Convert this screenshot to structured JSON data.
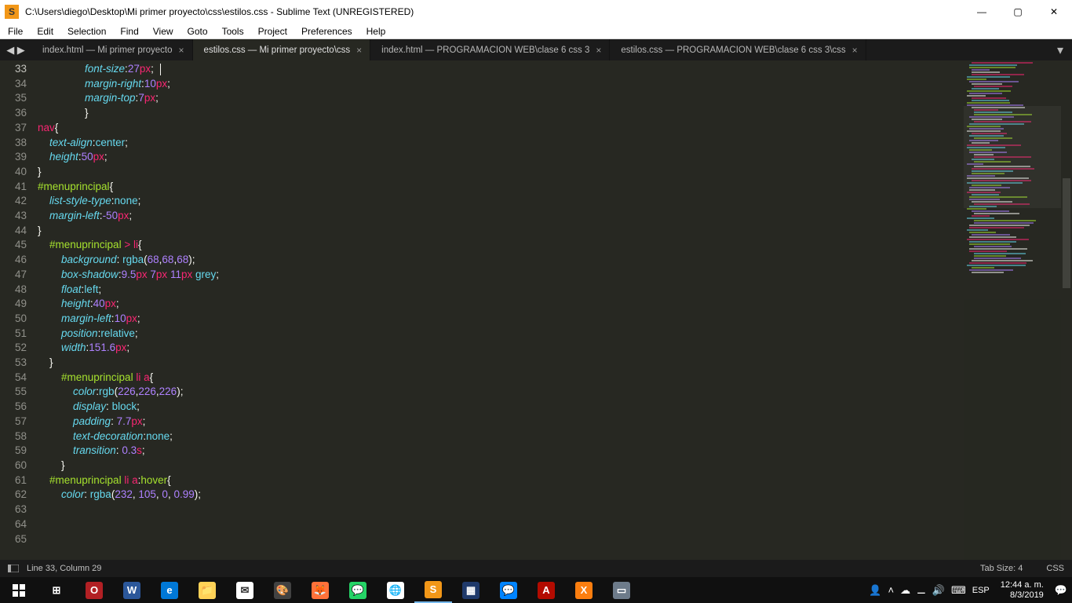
{
  "window": {
    "title": "C:\\Users\\diego\\Desktop\\Mi primer proyecto\\css\\estilos.css - Sublime Text (UNREGISTERED)",
    "app_icon_letter": "S"
  },
  "menubar": [
    "File",
    "Edit",
    "Selection",
    "Find",
    "View",
    "Goto",
    "Tools",
    "Project",
    "Preferences",
    "Help"
  ],
  "tabs": [
    {
      "label": "index.html — Mi primer proyecto",
      "active": false
    },
    {
      "label": "estilos.css — Mi primer proyecto\\css",
      "active": true
    },
    {
      "label": "index.html — PROGRAMACION  WEB\\clase 6 css 3",
      "active": false
    },
    {
      "label": "estilos.css — PROGRAMACION  WEB\\clase 6 css 3\\css",
      "active": false
    }
  ],
  "gutter": {
    "start": 33,
    "end": 65,
    "highlight": 33
  },
  "code_lines": [
    {
      "n": 33,
      "indent": "                ",
      "tokens": [
        [
          "prop",
          "font-size"
        ],
        [
          "punct",
          ":"
        ],
        [
          "num",
          "27"
        ],
        [
          "unit",
          "px"
        ],
        [
          "punct",
          ";"
        ]
      ],
      "cursor": true
    },
    {
      "n": 34,
      "indent": "                ",
      "tokens": [
        [
          "prop",
          "margin-right"
        ],
        [
          "punct",
          ":"
        ],
        [
          "num",
          "10"
        ],
        [
          "unit",
          "px"
        ],
        [
          "punct",
          ";"
        ]
      ]
    },
    {
      "n": 35,
      "indent": "                ",
      "tokens": [
        [
          "prop",
          "margin-top"
        ],
        [
          "punct",
          ":"
        ],
        [
          "num",
          "7"
        ],
        [
          "unit",
          "px"
        ],
        [
          "punct",
          ";"
        ]
      ]
    },
    {
      "n": 36,
      "indent": "                ",
      "tokens": [
        [
          "brace",
          "}"
        ]
      ]
    },
    {
      "n": 37,
      "indent": "",
      "tokens": []
    },
    {
      "n": 38,
      "indent": "",
      "tokens": [
        [
          "tagsel",
          "nav"
        ],
        [
          "brace",
          "{"
        ]
      ]
    },
    {
      "n": 39,
      "indent": "    ",
      "tokens": [
        [
          "prop",
          "text-align"
        ],
        [
          "punct",
          ":"
        ],
        [
          "val",
          "center"
        ],
        [
          "punct",
          ";"
        ]
      ]
    },
    {
      "n": 40,
      "indent": "    ",
      "tokens": [
        [
          "prop",
          "height"
        ],
        [
          "punct",
          ":"
        ],
        [
          "num",
          "50"
        ],
        [
          "unit",
          "px"
        ],
        [
          "punct",
          ";"
        ]
      ]
    },
    {
      "n": 41,
      "indent": "",
      "tokens": [
        [
          "brace",
          "}"
        ]
      ]
    },
    {
      "n": 42,
      "indent": "",
      "tokens": []
    },
    {
      "n": 43,
      "indent": "",
      "tokens": [
        [
          "idsel",
          "#menuprincipal"
        ],
        [
          "brace",
          "{"
        ]
      ]
    },
    {
      "n": 44,
      "indent": "    ",
      "tokens": [
        [
          "prop",
          "list-style-type"
        ],
        [
          "punct",
          ":"
        ],
        [
          "val",
          "none"
        ],
        [
          "punct",
          ";"
        ]
      ]
    },
    {
      "n": 45,
      "indent": "    ",
      "tokens": [
        [
          "prop",
          "margin-left"
        ],
        [
          "punct",
          ":"
        ],
        [
          "num",
          "-50"
        ],
        [
          "unit",
          "px"
        ],
        [
          "punct",
          ";"
        ]
      ]
    },
    {
      "n": 46,
      "indent": "",
      "tokens": [
        [
          "brace",
          "}"
        ]
      ]
    },
    {
      "n": 47,
      "indent": "    ",
      "tokens": [
        [
          "idsel",
          "#menuprincipal"
        ],
        [
          "punct",
          " "
        ],
        [
          "op",
          ">"
        ],
        [
          "punct",
          " "
        ],
        [
          "tagsel",
          "li"
        ],
        [
          "brace",
          "{"
        ]
      ]
    },
    {
      "n": 48,
      "indent": "        ",
      "tokens": [
        [
          "prop",
          "background"
        ],
        [
          "punct",
          ": "
        ],
        [
          "rgbfn",
          "rgba"
        ],
        [
          "paren",
          "("
        ],
        [
          "num",
          "68"
        ],
        [
          "comma",
          ","
        ],
        [
          "num",
          "68"
        ],
        [
          "comma",
          ","
        ],
        [
          "num",
          "68"
        ],
        [
          "paren",
          ")"
        ],
        [
          "punct",
          ";"
        ]
      ]
    },
    {
      "n": 49,
      "indent": "        ",
      "tokens": [
        [
          "prop",
          "box-shadow"
        ],
        [
          "punct",
          ":"
        ],
        [
          "num",
          "9.5"
        ],
        [
          "unit",
          "px"
        ],
        [
          "punct",
          " "
        ],
        [
          "num",
          "7"
        ],
        [
          "unit",
          "px"
        ],
        [
          "punct",
          " "
        ],
        [
          "num",
          "11"
        ],
        [
          "unit",
          "px"
        ],
        [
          "punct",
          " "
        ],
        [
          "val",
          "grey"
        ],
        [
          "punct",
          ";"
        ]
      ]
    },
    {
      "n": 50,
      "indent": "        ",
      "tokens": [
        [
          "prop",
          "float"
        ],
        [
          "punct",
          ":"
        ],
        [
          "val",
          "left"
        ],
        [
          "punct",
          ";"
        ]
      ]
    },
    {
      "n": 51,
      "indent": "        ",
      "tokens": [
        [
          "prop",
          "height"
        ],
        [
          "punct",
          ":"
        ],
        [
          "num",
          "40"
        ],
        [
          "unit",
          "px"
        ],
        [
          "punct",
          ";"
        ]
      ]
    },
    {
      "n": 52,
      "indent": "        ",
      "tokens": [
        [
          "prop",
          "margin-left"
        ],
        [
          "punct",
          ":"
        ],
        [
          "num",
          "10"
        ],
        [
          "unit",
          "px"
        ],
        [
          "punct",
          ";"
        ]
      ]
    },
    {
      "n": 53,
      "indent": "        ",
      "tokens": [
        [
          "prop",
          "position"
        ],
        [
          "punct",
          ":"
        ],
        [
          "val",
          "relative"
        ],
        [
          "punct",
          ";"
        ]
      ]
    },
    {
      "n": 54,
      "indent": "        ",
      "tokens": [
        [
          "prop",
          "width"
        ],
        [
          "punct",
          ":"
        ],
        [
          "num",
          "151.6"
        ],
        [
          "unit",
          "px"
        ],
        [
          "punct",
          ";"
        ]
      ]
    },
    {
      "n": 55,
      "indent": "",
      "tokens": []
    },
    {
      "n": 56,
      "indent": "    ",
      "tokens": [
        [
          "brace",
          "}"
        ]
      ]
    },
    {
      "n": 57,
      "indent": "        ",
      "tokens": [
        [
          "idsel",
          "#menuprincipal"
        ],
        [
          "punct",
          " "
        ],
        [
          "tagsel",
          "li"
        ],
        [
          "punct",
          " "
        ],
        [
          "tagsel",
          "a"
        ],
        [
          "brace",
          "{"
        ]
      ]
    },
    {
      "n": 58,
      "indent": "            ",
      "tokens": [
        [
          "prop",
          "color"
        ],
        [
          "punct",
          ":"
        ],
        [
          "rgbfn",
          "rgb"
        ],
        [
          "paren",
          "("
        ],
        [
          "num",
          "226"
        ],
        [
          "comma",
          ","
        ],
        [
          "num",
          "226"
        ],
        [
          "comma",
          ","
        ],
        [
          "num",
          "226"
        ],
        [
          "paren",
          ")"
        ],
        [
          "punct",
          ";"
        ]
      ]
    },
    {
      "n": 59,
      "indent": "            ",
      "tokens": [
        [
          "prop",
          "display"
        ],
        [
          "punct",
          ": "
        ],
        [
          "val",
          "block"
        ],
        [
          "punct",
          ";"
        ]
      ]
    },
    {
      "n": 60,
      "indent": "            ",
      "tokens": [
        [
          "prop",
          "padding"
        ],
        [
          "punct",
          ": "
        ],
        [
          "num",
          "7.7"
        ],
        [
          "unit",
          "px"
        ],
        [
          "punct",
          ";"
        ]
      ]
    },
    {
      "n": 61,
      "indent": "            ",
      "tokens": [
        [
          "prop",
          "text-decoration"
        ],
        [
          "punct",
          ":"
        ],
        [
          "val",
          "none"
        ],
        [
          "punct",
          ";"
        ]
      ]
    },
    {
      "n": 62,
      "indent": "            ",
      "tokens": [
        [
          "prop",
          "transition"
        ],
        [
          "punct",
          ": "
        ],
        [
          "num",
          "0.3"
        ],
        [
          "unit",
          "s"
        ],
        [
          "punct",
          ";"
        ]
      ]
    },
    {
      "n": 63,
      "indent": "        ",
      "tokens": [
        [
          "brace",
          "}"
        ]
      ]
    },
    {
      "n": 64,
      "indent": "    ",
      "tokens": [
        [
          "idsel",
          "#menuprincipal"
        ],
        [
          "punct",
          " "
        ],
        [
          "tagsel",
          "li"
        ],
        [
          "punct",
          " "
        ],
        [
          "tagsel",
          "a"
        ],
        [
          "punct",
          ":"
        ],
        [
          "pseudo",
          "hover"
        ],
        [
          "brace",
          "{"
        ]
      ]
    },
    {
      "n": 65,
      "indent": "        ",
      "tokens": [
        [
          "prop",
          "color"
        ],
        [
          "punct",
          ": "
        ],
        [
          "rgbfn",
          "rgba"
        ],
        [
          "paren",
          "("
        ],
        [
          "num",
          "232"
        ],
        [
          "comma",
          ", "
        ],
        [
          "num",
          "105"
        ],
        [
          "comma",
          ", "
        ],
        [
          "num",
          "0"
        ],
        [
          "comma",
          ", "
        ],
        [
          "num",
          "0.99"
        ],
        [
          "paren",
          ")"
        ],
        [
          "punct",
          ";"
        ]
      ]
    }
  ],
  "statusbar": {
    "cursor": "Line 33, Column 29",
    "tab_size": "Tab Size: 4",
    "syntax": "CSS"
  },
  "tray": {
    "lang": "ESP",
    "time": "12:44 a. m.",
    "date": "8/3/2019"
  },
  "taskbar_icons": [
    {
      "name": "start",
      "bg": "",
      "glyph": ""
    },
    {
      "name": "taskview",
      "bg": "",
      "glyph": "⊞"
    },
    {
      "name": "opera",
      "bg": "#b22024",
      "glyph": "O"
    },
    {
      "name": "word",
      "bg": "#2b579a",
      "glyph": "W"
    },
    {
      "name": "edge",
      "bg": "#0078d7",
      "glyph": "e"
    },
    {
      "name": "explorer",
      "bg": "#ffd257",
      "glyph": "📁"
    },
    {
      "name": "mail",
      "bg": "#fff",
      "glyph": "✉"
    },
    {
      "name": "paint3d",
      "bg": "#424242",
      "glyph": "🎨"
    },
    {
      "name": "firefox",
      "bg": "#ff7139",
      "glyph": "🦊"
    },
    {
      "name": "whatsapp",
      "bg": "#25d366",
      "glyph": "💬"
    },
    {
      "name": "chrome",
      "bg": "#fff",
      "glyph": "🌐"
    },
    {
      "name": "sublime",
      "bg": "#f29718",
      "glyph": "S"
    },
    {
      "name": "app1",
      "bg": "#203a6b",
      "glyph": "▦"
    },
    {
      "name": "messenger",
      "bg": "#0084ff",
      "glyph": "💬"
    },
    {
      "name": "acrobat",
      "bg": "#b30b00",
      "glyph": "A"
    },
    {
      "name": "xampp",
      "bg": "#fc7e0f",
      "glyph": "X"
    },
    {
      "name": "app2",
      "bg": "#6d7b8a",
      "glyph": "▭"
    }
  ]
}
